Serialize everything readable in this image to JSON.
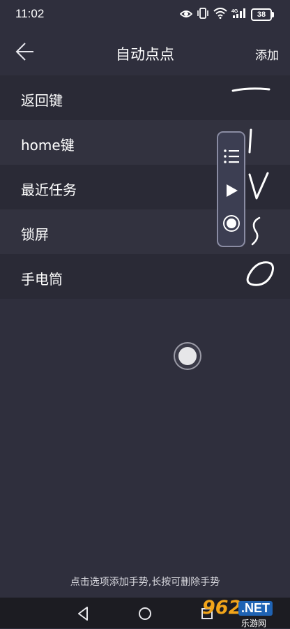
{
  "status_bar": {
    "time": "11:02",
    "battery": "38",
    "network": "4G",
    "icons": [
      "eye-icon",
      "vibrate-icon",
      "wifi-icon",
      "signal-icon",
      "battery-icon"
    ]
  },
  "header": {
    "title": "自动点点",
    "action_label": "添加",
    "back_icon": "back-arrow-icon"
  },
  "items": [
    {
      "label": "返回键",
      "gesture": "horizontal-line"
    },
    {
      "label": "home键",
      "gesture": "vertical-line"
    },
    {
      "label": "最近任务",
      "gesture": "v-shape"
    },
    {
      "label": "锁屏",
      "gesture": "s-shape"
    },
    {
      "label": "手电筒",
      "gesture": "o-shape"
    }
  ],
  "floating_panel": {
    "buttons": [
      "list-icon",
      "play-icon",
      "record-icon"
    ]
  },
  "hint": "点击选项添加手势,长按可删除手势",
  "nav_bar": {
    "buttons": [
      "back-triangle-icon",
      "home-circle-icon",
      "recents-square-icon"
    ]
  },
  "watermark": {
    "number": "962",
    "domain": ".NET",
    "subtitle": "乐游网"
  },
  "colors": {
    "background": "#2f2f3d",
    "row_dark": "#2a2a36",
    "row_light": "#32323f",
    "panel_border": "#8a8ca3",
    "watermark_orange": "#f2a51a",
    "watermark_blue": "#1f63b4"
  }
}
